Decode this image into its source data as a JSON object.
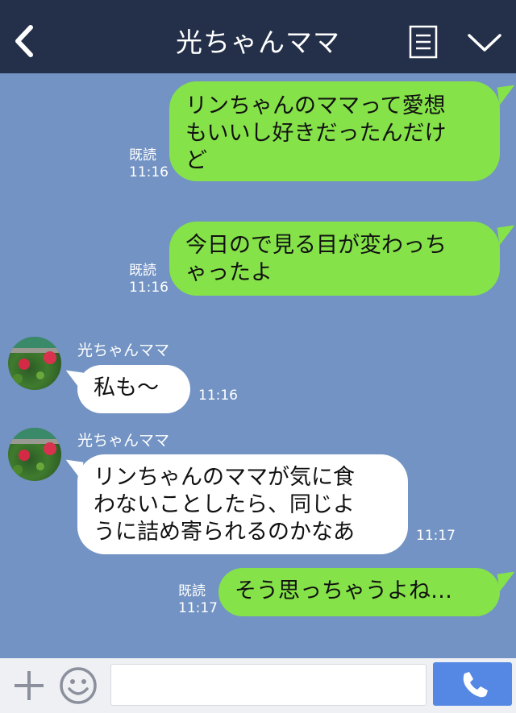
{
  "header": {
    "title": "光ちゃんママ",
    "back_icon": "chevron-left-icon",
    "menu_icon": "menu-list-icon",
    "expand_icon": "chevron-down-icon"
  },
  "messages": [
    {
      "side": "right",
      "text": "リンちゃんのママって愛想\nもいいし好きだったんだけ\nど",
      "read": "既読",
      "time": "11:16"
    },
    {
      "side": "right",
      "text": "今日ので見る目が変わっち\nゃったよ",
      "read": "既読",
      "time": "11:16"
    },
    {
      "side": "left",
      "sender": "光ちゃんママ",
      "text": "私も～",
      "time": "11:16"
    },
    {
      "side": "left",
      "sender": "光ちゃんママ",
      "text": "リンちゃんのママが気に食\nわないことしたら、同じよ\nうに詰め寄られるのかなあ",
      "time": "11:17"
    },
    {
      "side": "right",
      "text": "そう思っちゃうよね…",
      "read": "既読",
      "time": "11:17"
    }
  ],
  "footer": {
    "plus_icon": "plus-icon",
    "emoji_icon": "smiley-icon",
    "input_value": "",
    "call_icon": "phone-icon"
  },
  "colors": {
    "header_bg": "#243049",
    "chat_bg": "#7293c3",
    "bubble_green": "#85e249",
    "bubble_white": "#ffffff",
    "call_button": "#5588e5"
  }
}
